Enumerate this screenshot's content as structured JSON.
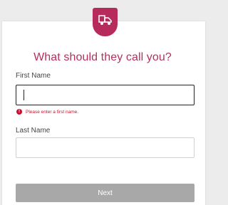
{
  "brand": {
    "logo_icon": "truck-icon",
    "accent_color": "#b72a5c"
  },
  "form": {
    "title": "What should they call you?",
    "first_name": {
      "label": "First Name",
      "value": "",
      "error": "Please enter a first name."
    },
    "last_name": {
      "label": "Last Name",
      "value": ""
    },
    "next_label": "Next"
  }
}
